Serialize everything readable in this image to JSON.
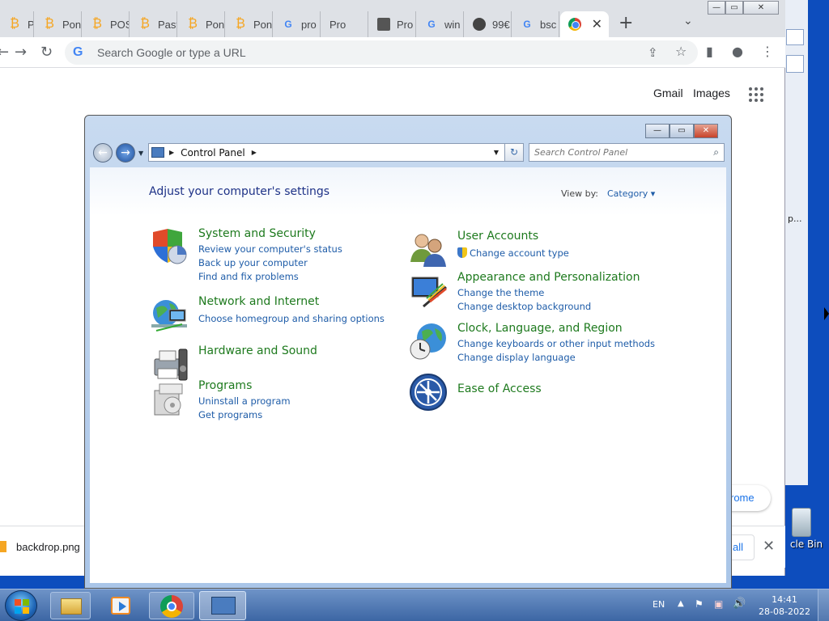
{
  "browser": {
    "tabs": [
      {
        "label": "Pon",
        "icon": "bitcoin-icon"
      },
      {
        "label": "Pon",
        "icon": "bitcoin-icon"
      },
      {
        "label": "POS",
        "icon": "bitcoin-icon"
      },
      {
        "label": "Past",
        "icon": "bitcoin-icon"
      },
      {
        "label": "Pon",
        "icon": "bitcoin-icon"
      },
      {
        "label": "Pon",
        "icon": "bitcoin-icon"
      },
      {
        "label": "pro",
        "icon": "google-icon"
      },
      {
        "label": "Pro",
        "icon": "control-panel-icon"
      },
      {
        "label": "Pro",
        "icon": "printer-icon"
      },
      {
        "label": "win",
        "icon": "google-icon"
      },
      {
        "label": "99€",
        "icon": "globe-icon"
      },
      {
        "label": "bsc",
        "icon": "google-icon"
      }
    ],
    "omnibox_placeholder": "Search Google or type a URL",
    "header_links": [
      "Gmail",
      "Images"
    ],
    "sign_in_partial": "rome",
    "download_file": "backdrop.png",
    "show_all_partial": "all"
  },
  "desktop": {
    "recycle_bin_partial": "cle Bin",
    "bg_window_text": "p..."
  },
  "control_panel": {
    "breadcrumb": "Control Panel",
    "search_placeholder": "Search Control Panel",
    "heading": "Adjust your computer's settings",
    "view_by_label": "View by:",
    "view_by_value": "Category",
    "categories": {
      "system": {
        "title": "System and Security",
        "links": [
          "Review your computer's status",
          "Back up your computer",
          "Find and fix problems"
        ]
      },
      "network": {
        "title": "Network and Internet",
        "links": [
          "Choose homegroup and sharing options"
        ]
      },
      "hardware": {
        "title": "Hardware and Sound"
      },
      "programs": {
        "title": "Programs",
        "links": [
          "Uninstall a program",
          "Get programs"
        ]
      },
      "users": {
        "title": "User Accounts",
        "links": [
          "Change account type"
        ]
      },
      "appearance": {
        "title": "Appearance and Personalization",
        "links": [
          "Change the theme",
          "Change desktop background"
        ]
      },
      "clock": {
        "title": "Clock, Language, and Region",
        "links": [
          "Change keyboards or other input methods",
          "Change display language"
        ]
      },
      "ease": {
        "title": "Ease of Access"
      }
    }
  },
  "taskbar": {
    "language": "EN",
    "time": "14:41",
    "date": "28-08-2022"
  }
}
